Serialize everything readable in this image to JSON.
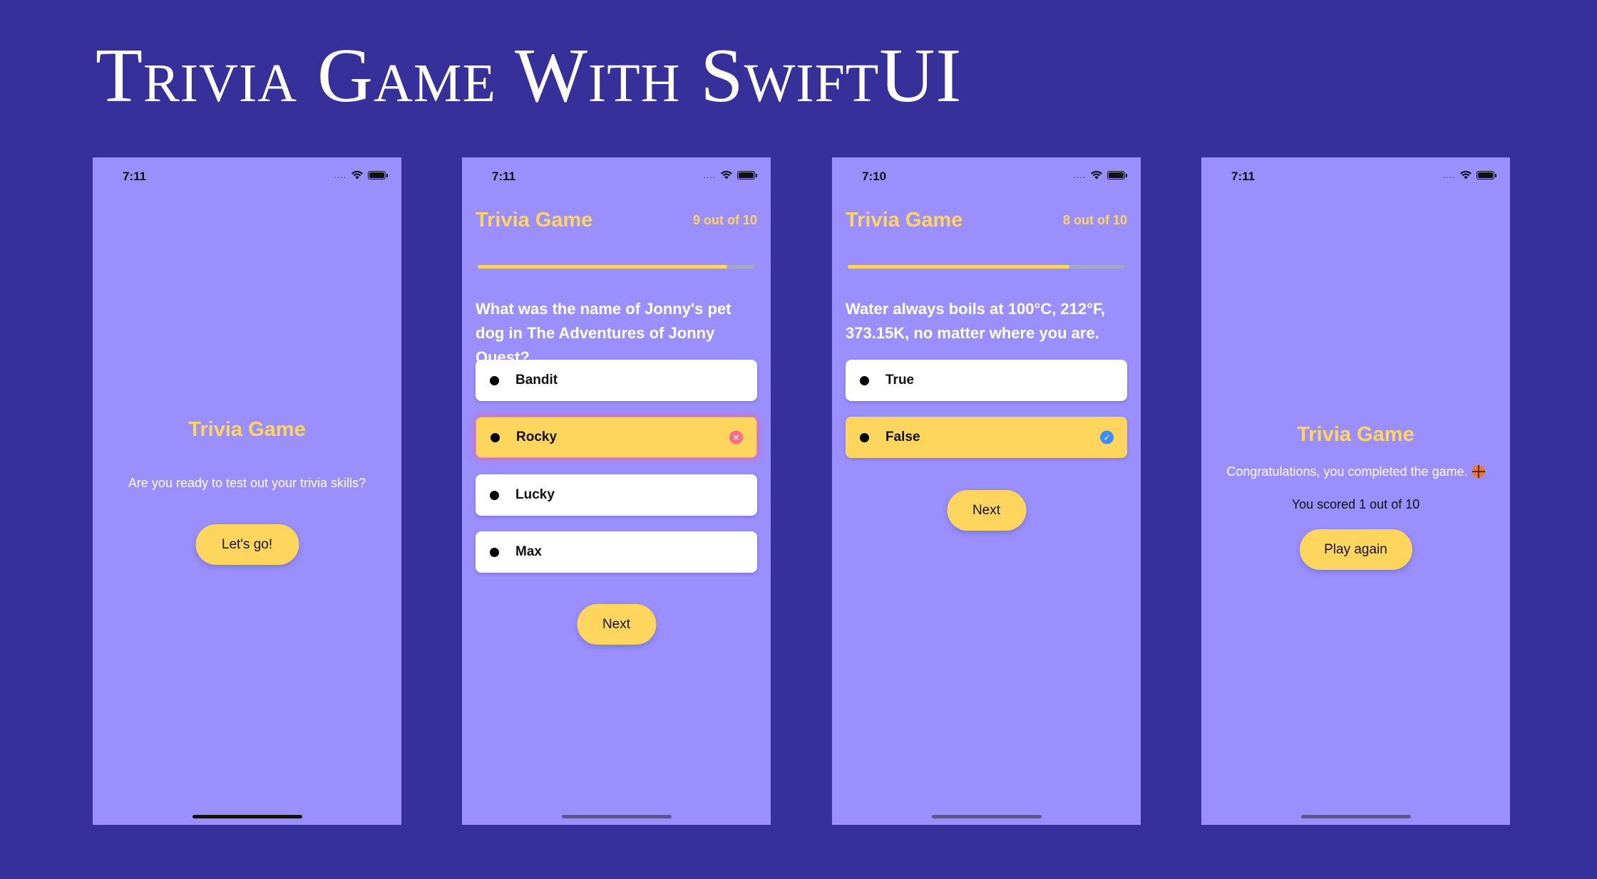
{
  "headline": "Trivia Game With SwiftUI",
  "screens": [
    {
      "time": "7:11",
      "title": "Trivia Game",
      "subtitle": "Are you ready to test out your trivia skills?",
      "button": "Let's go!"
    },
    {
      "time": "7:11",
      "title": "Trivia Game",
      "progress_label": "9 out of 10",
      "progress_fraction": 0.9,
      "question": "What was the name of Jonny's pet dog in The Adventures of Jonny Quest?",
      "answers": [
        "Bandit",
        "Rocky",
        "Lucky",
        "Max"
      ],
      "selected": "Rocky",
      "selected_state": "incorrect",
      "button": "Next"
    },
    {
      "time": "7:10",
      "title": "Trivia Game",
      "progress_label": "8 out of 10",
      "progress_fraction": 0.8,
      "question": "Water always boils at 100°C, 212°F, 373.15K, no matter where you are.",
      "answers": [
        "True",
        "False"
      ],
      "selected": "False",
      "selected_state": "correct",
      "button": "Next"
    },
    {
      "time": "7:11",
      "title": "Trivia Game",
      "message": "Congratulations, you completed the game.",
      "message_icon": "basketball-emoji",
      "score": "You scored 1 out of 10",
      "button": "Play again"
    }
  ],
  "colors": {
    "background": "#37309b",
    "screen": "#9a8ffd",
    "accent": "#fed65e",
    "incorrect": "#ff6b8b",
    "correct": "#3d8bfd"
  },
  "icons": {
    "signal": "signal-dots-icon",
    "wifi": "wifi-icon",
    "battery": "battery-icon"
  }
}
